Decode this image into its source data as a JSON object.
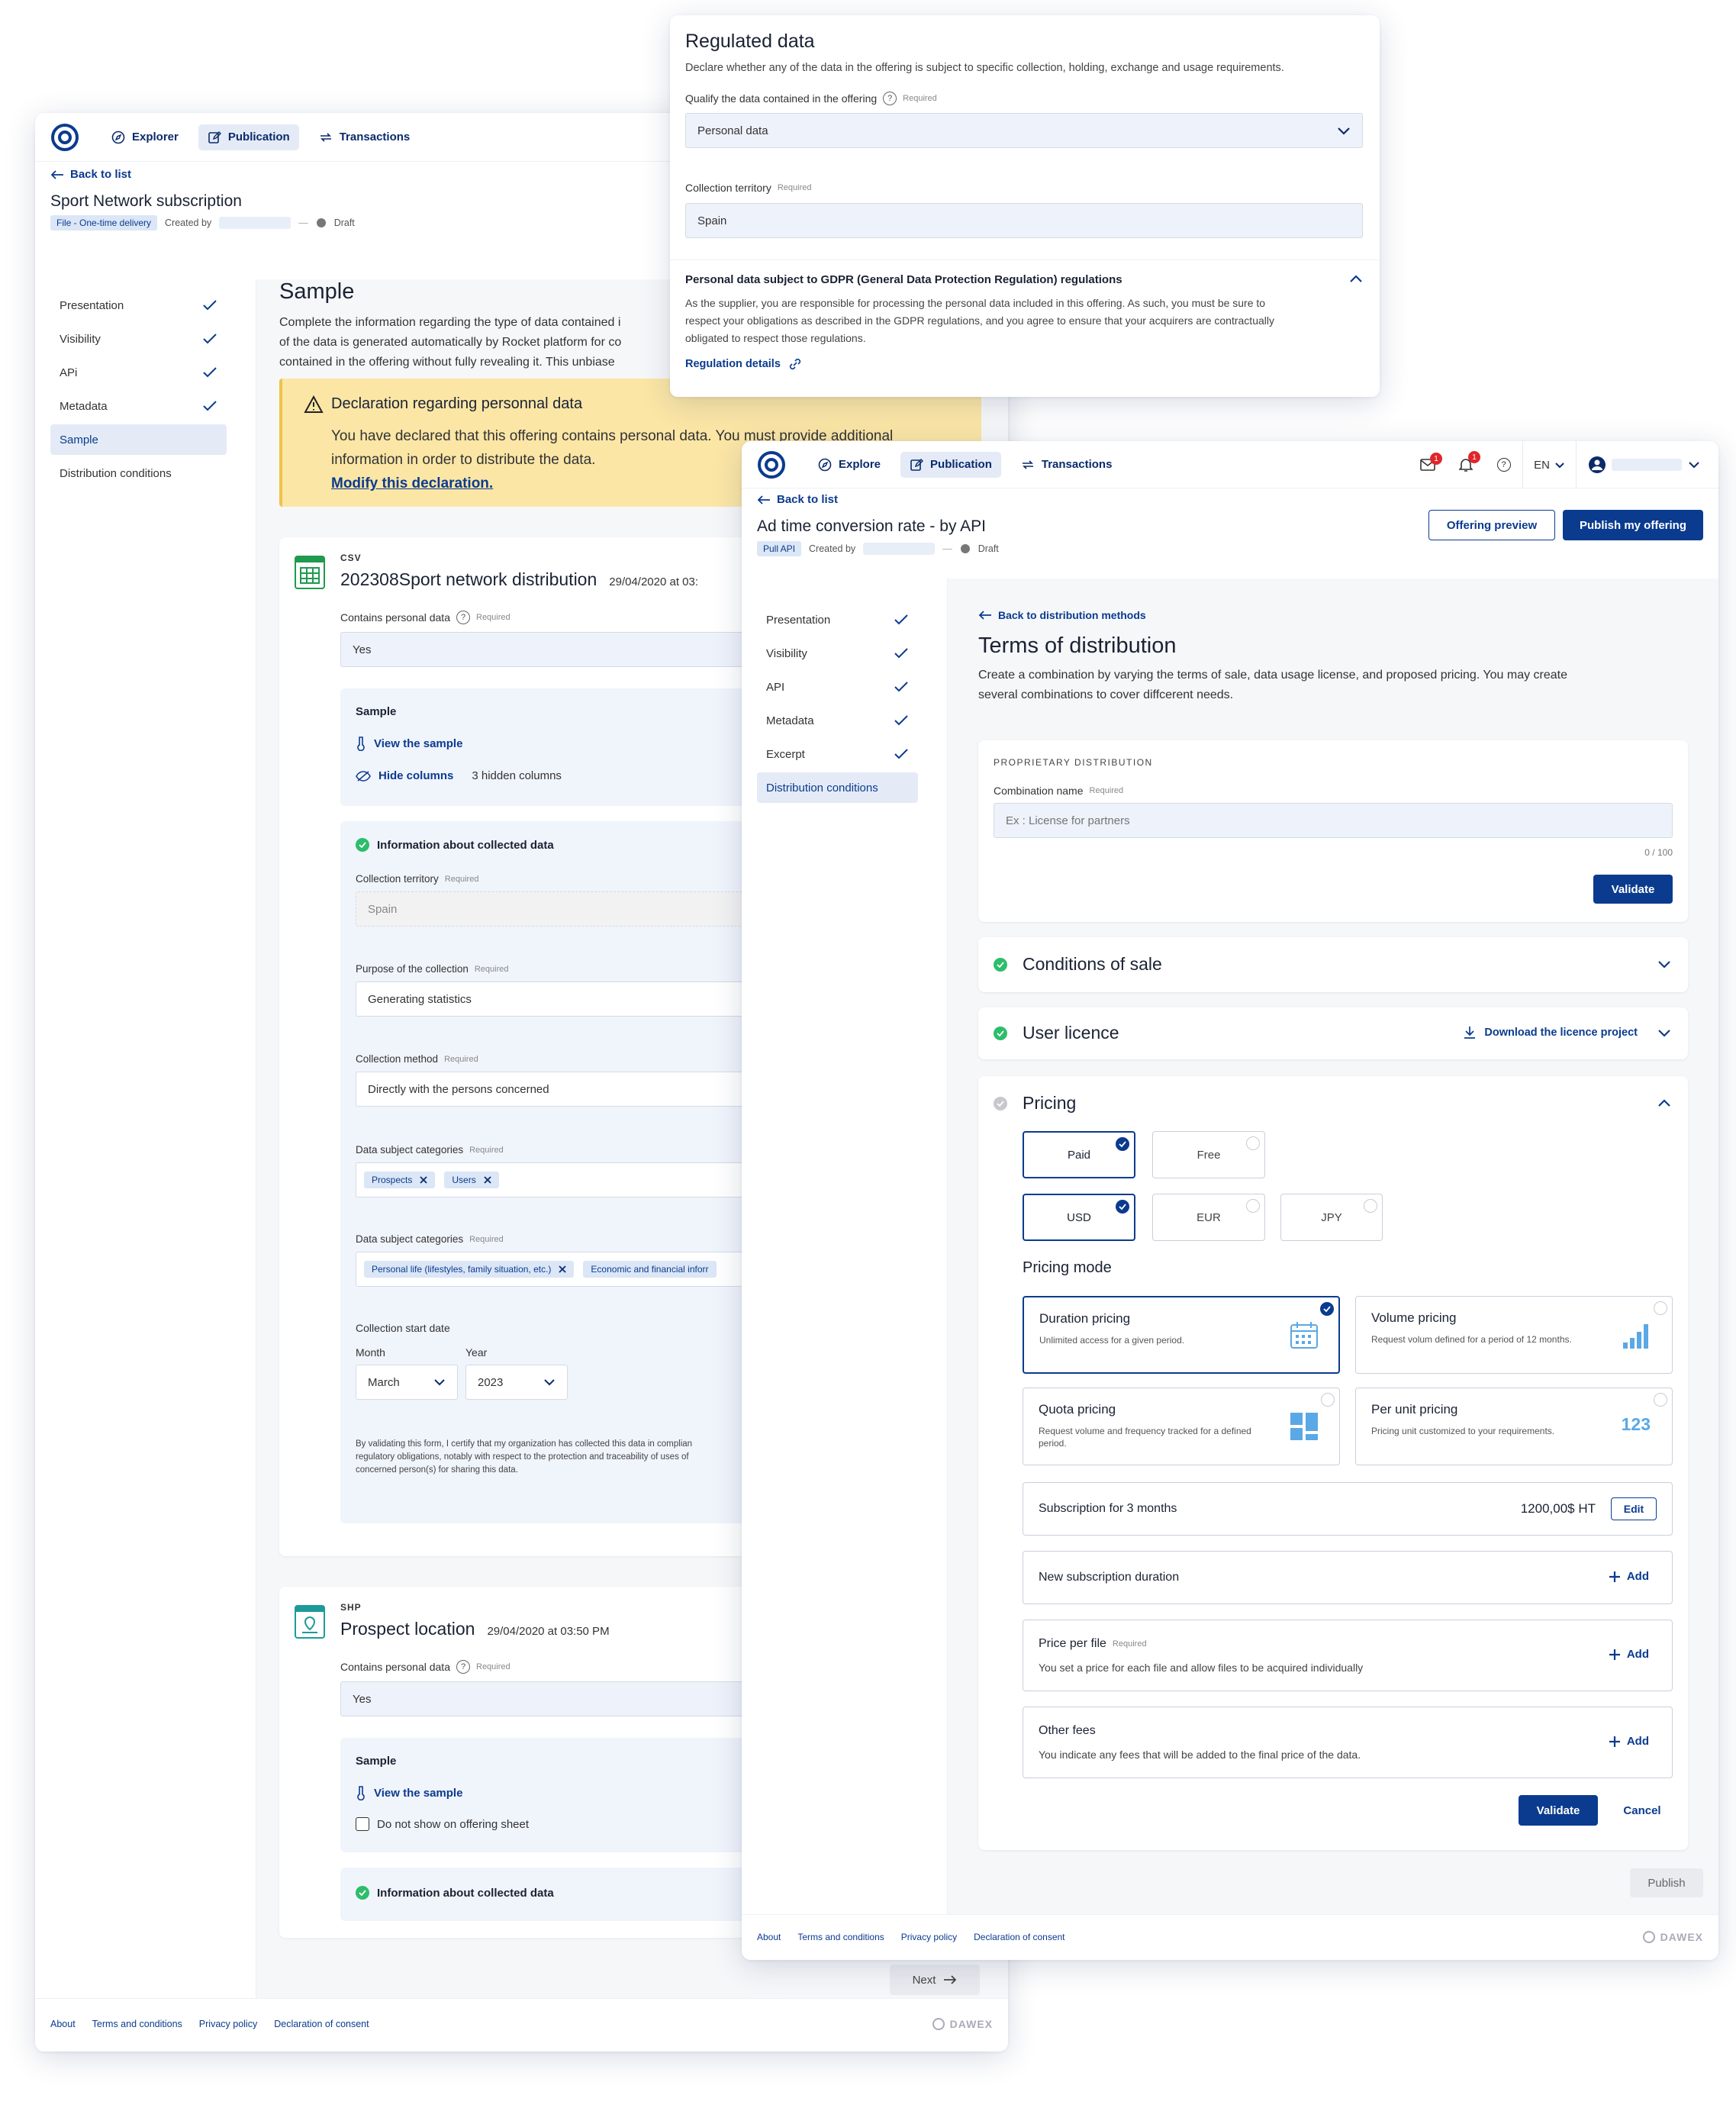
{
  "w1": {
    "nav": {
      "explorer": "Explorer",
      "publication": "Publication",
      "transactions": "Transactions"
    },
    "back": "Back to list",
    "title": "Sport Network subscription",
    "tag": "File - One-time delivery",
    "created_by": "Created by",
    "status": "Draft",
    "sidebar": [
      "Presentation",
      "Visibility",
      "APi",
      "Metadata",
      "Sample",
      "Distribution conditions"
    ],
    "sample_title": "Sample",
    "sample_desc": [
      "Complete the information regarding the type of data contained i",
      "of the data is generated automatically by Rocket platform for co",
      "contained in the offering without fully revealing it. This unbiase"
    ],
    "warning": {
      "title": "Declaration regarding personnal data",
      "text1": "You have declared that this offering contains personal data. You must provide additional",
      "text2": "information in order to distribute the data.",
      "link": "Modify this declaration."
    },
    "file1": {
      "type": "CSV",
      "name": "202308Sport network distribution",
      "date": "29/04/2020 at 03:",
      "contains_label": "Contains personal data",
      "required": "Required",
      "contains_value": "Yes",
      "sample_label": "Sample",
      "view_sample": "View the sample",
      "hide_columns": "Hide columns",
      "hidden_count": "3 hidden columns",
      "info_title": "Information about collected data",
      "territory_label": "Collection territory",
      "territory_value": "Spain",
      "purpose_label": "Purpose of the collection",
      "purpose_value": "Generating statistics",
      "method_label": "Collection method",
      "method_value": "Directly with the persons concerned",
      "cat1_label": "Data subject categories",
      "cat1_chips": [
        "Prospects",
        "Users"
      ],
      "cat2_label": "Data subject categories",
      "cat2_chips": [
        "Personal life (lifestyles, family situation, etc.)",
        "Economic  and financial inforr"
      ],
      "start_label": "Collection start date",
      "month_label": "Month",
      "month_value": "March",
      "year_label": "Year",
      "year_value": "2023",
      "certify": [
        "By validating this form, I certify that my organization has collected this data in complian",
        "regulatory obligations, notably with respect to the protection and traceability of uses of",
        "concerned person(s) for sharing this data."
      ]
    },
    "file2": {
      "type": "SHP",
      "name": "Prospect location",
      "date": "29/04/2020 at 03:50 PM",
      "contains_label": "Contains personal data",
      "required": "Required",
      "contains_value": "Yes",
      "sample_label": "Sample",
      "view_sample": "View the sample",
      "no_show": "Do not show on offering sheet",
      "info_title": "Information about collected data"
    },
    "next": "Next",
    "footer": [
      "About",
      "Terms and conditions",
      "Privacy policy",
      "Declaration of consent"
    ],
    "brand": "DAWEX"
  },
  "w2": {
    "title": "Regulated data",
    "desc": "Declare whether any of the data in the offering is subject to specific collection, holding, exchange and usage requirements.",
    "qualify_label": "Qualify the data contained in the offering",
    "required": "Required",
    "qualify_value": "Personal data",
    "territory_label": "Collection territory",
    "territory_value": "Spain",
    "gdpr_title": "Personal data subject to GDPR (General Data Protection Regulation) regulations",
    "gdpr_text": [
      "As the supplier, you are responsible for processing the personal data included in this offering. As such, you must be sure to",
      "respect your obligations as described in the GDPR regulations, and you agree to ensure that your acquirers are contractually",
      "obligated to respect those regulations."
    ],
    "link": "Regulation details"
  },
  "w3": {
    "nav": {
      "explore": "Explore",
      "publication": "Publication",
      "transactions": "Transactions",
      "lang": "EN",
      "mail_badge": "1",
      "bell_badge": "1"
    },
    "back": "Back to list",
    "title": "Ad time conversion rate - by API",
    "tag": "Pull API",
    "created_by": "Created by",
    "status": "Draft",
    "preview": "Offering preview",
    "publish_offering": "Publish my offering",
    "sidebar": [
      "Presentation",
      "Visibility",
      "API",
      "Metadata",
      "Excerpt",
      "Distribution conditions"
    ],
    "back_methods": "Back to distribution methods",
    "terms_title": "Terms of distribution",
    "terms_desc": [
      "Create a combination by varying the terms of sale, data usage license, and proposed pricing. You may create",
      "several combinations to cover diffcerent needs."
    ],
    "proprietary": "PROPRIETARY DISTRIBUTION",
    "combo_label": "Combination name",
    "required": "Required",
    "combo_placeholder": "Ex : License for partners",
    "counter": "0 / 100",
    "validate": "Validate",
    "conditions": "Conditions of sale",
    "licence": "User licence",
    "download": "Download the licence project",
    "pricing": "Pricing",
    "pay": [
      "Paid",
      "Free"
    ],
    "currency": [
      "USD",
      "EUR",
      "JPY"
    ],
    "mode_title": "Pricing mode",
    "modes": [
      {
        "t": "Duration pricing",
        "d": "Unlimited access for a given period.",
        "icon": "calendar-icon"
      },
      {
        "t": "Volume pricing",
        "d": "Request volum defined for a period of 12 months.",
        "icon": "bar-chart-icon"
      },
      {
        "t": "Quota pricing",
        "d": "Request volume and frequency tracked for a defined period.",
        "icon": "blocks-icon"
      },
      {
        "t": "Per unit pricing",
        "d": "Pricing unit customized to your requirements.",
        "icon": "123-icon",
        "icon_text": "123"
      }
    ],
    "subscription": "Subscription for 3 months",
    "price": "1200,00$ HT",
    "edit": "Edit",
    "new_duration": "New subscription duration",
    "add": "Add",
    "price_file": "Price per file",
    "price_file_desc": "You set a price for each file and allow files to be acquired individually",
    "other_fees": "Other fees",
    "other_fees_desc": "You indicate any fees that will be added to the final price of the data.",
    "cancel": "Cancel",
    "publish": "Publish",
    "footer": [
      "About",
      "Terms and conditions",
      "Privacy policy",
      "Declaration of consent"
    ],
    "brand": "DAWEX"
  },
  "colors": {
    "primary": "#0b3b8f",
    "success": "#2ebd6b",
    "warning_bg": "#fbe6a6",
    "badge": "#e0262b"
  }
}
